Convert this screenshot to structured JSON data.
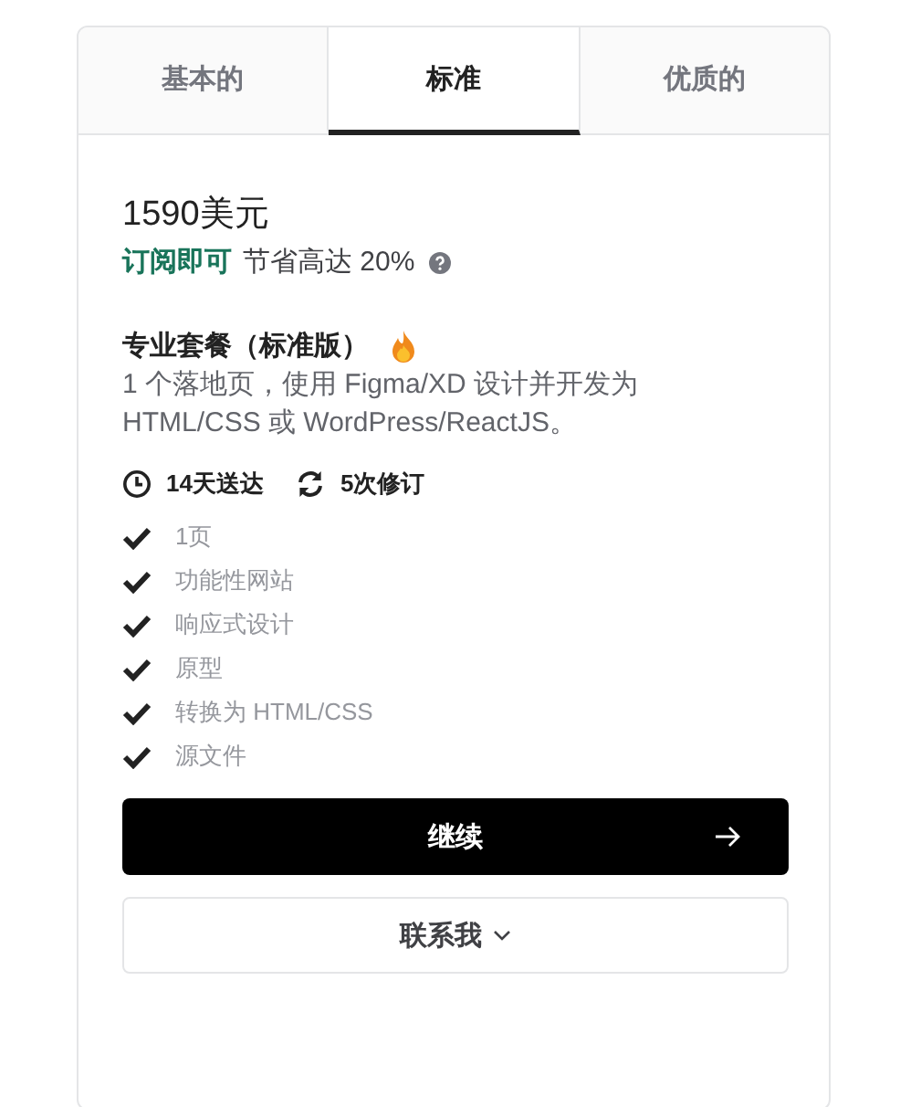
{
  "tabs": [
    {
      "label": "基本的",
      "selected": false
    },
    {
      "label": "标准",
      "selected": true
    },
    {
      "label": "优质的",
      "selected": false
    }
  ],
  "price": "1590美元",
  "subscribe": {
    "label": "订阅即可",
    "savings": "节省高达 20%"
  },
  "plan": {
    "name": "专业套餐（标准版）",
    "description": "1 个落地页，使用 Figma/XD 设计并开发为 HTML/CSS 或 WordPress/ReactJS。"
  },
  "meta": [
    {
      "kind": "delivery",
      "label": "14天送达"
    },
    {
      "kind": "revisions",
      "label": "5次修订"
    }
  ],
  "features": [
    {
      "label": "1页",
      "included": true
    },
    {
      "label": "功能性网站",
      "included": true
    },
    {
      "label": "响应式设计",
      "included": true
    },
    {
      "label": "原型",
      "included": true
    },
    {
      "label": "转换为 HTML/CSS",
      "included": true
    },
    {
      "label": "源文件",
      "included": true
    }
  ],
  "buttons": {
    "continue": "继续",
    "contact": "联系我"
  }
}
